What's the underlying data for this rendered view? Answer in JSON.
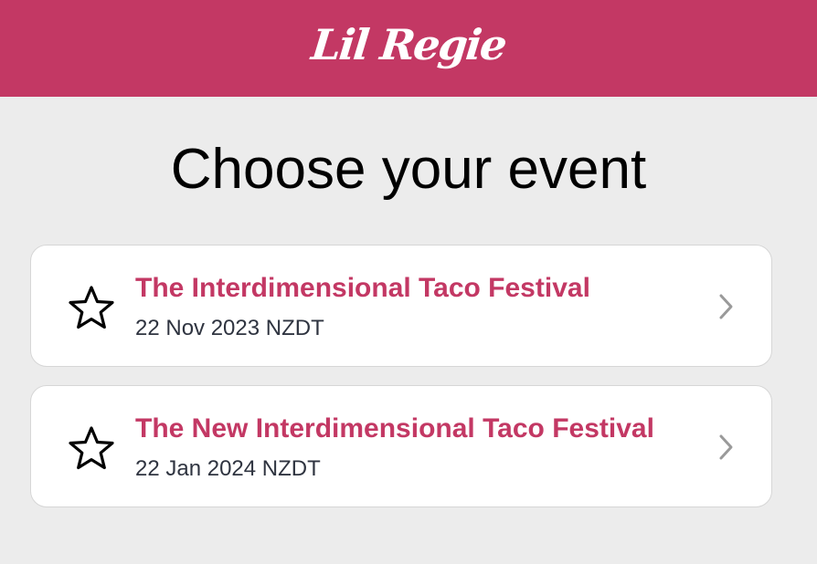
{
  "app": {
    "logo_text": "Lil Regie",
    "brand_color": "#c33864"
  },
  "page": {
    "title": "Choose your event"
  },
  "events": [
    {
      "name": "The Interdimensional Taco Festival",
      "date": "22 Nov 2023 NZDT",
      "icon": "star-outline-icon",
      "action_icon": "chevron-right-icon"
    },
    {
      "name": "The New Interdimensional Taco Festival",
      "date": "22 Jan 2024 NZDT",
      "icon": "star-outline-icon",
      "action_icon": "chevron-right-icon"
    }
  ]
}
